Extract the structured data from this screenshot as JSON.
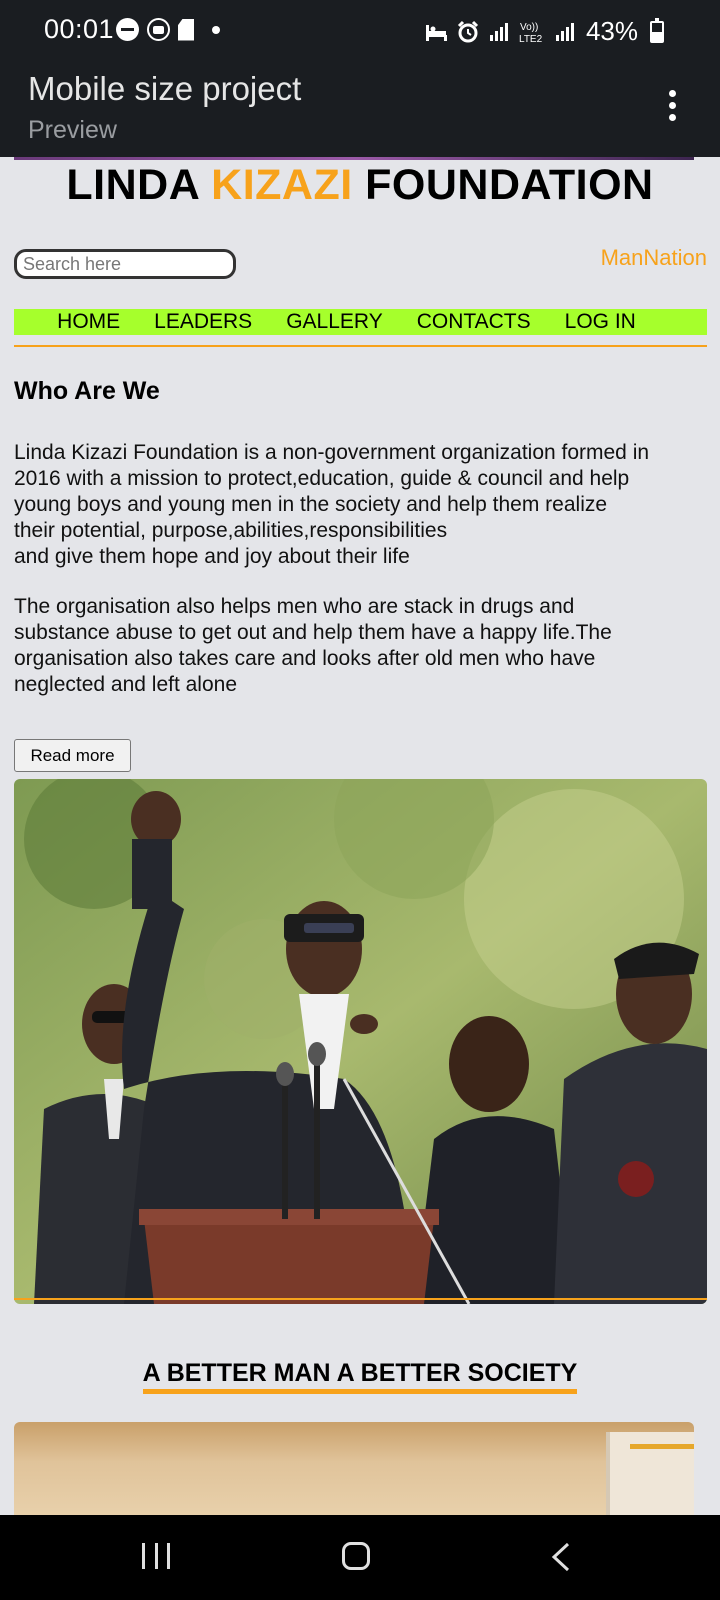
{
  "status_bar": {
    "time": "00:01",
    "battery": "43%",
    "network_label": "Vo)) LTE2"
  },
  "app_bar": {
    "title": "Mobile size project",
    "subtitle": "Preview",
    "menu_icon": "more-vert-icon"
  },
  "site": {
    "title_part1": "LINDA ",
    "title_accent": "KIZAZI",
    "title_part2": " FOUNDATION",
    "accent_color": "#f7a21b",
    "search_placeholder": "Search here",
    "brand_link": "ManNation",
    "nav": {
      "background": "#a6ff2c",
      "items": [
        "HOME",
        "LEADERS",
        "GALLERY",
        "CONTACTS",
        "LOG IN"
      ]
    },
    "about": {
      "heading": "Who Are We",
      "para1_lines": [
        "Linda Kizazi Foundation is a non-government organization formed in",
        "2016 with a mission to protect,education, guide & council and help",
        "young boys and young men in the society and help them realize",
        "their potential, purpose,abilities,responsibilities",
        "and give them hope and joy about their life"
      ],
      "para2_lines": [
        "The organisation also helps men who are stack in drugs and",
        "substance abuse to get out and help them have a happy life.The",
        "organisation also takes care and looks after old men who have",
        "neglected and left alone"
      ],
      "read_more": "Read more"
    },
    "slogan": "A BETTER MAN A BETTER SOCIETY"
  }
}
